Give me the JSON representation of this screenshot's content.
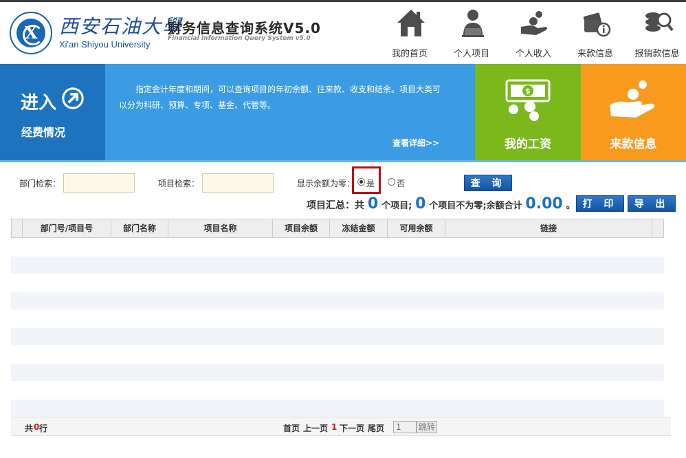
{
  "header": {
    "university_cn": "西安石油大學",
    "university_en": "Xi'an Shiyou University",
    "system_title": "财务信息查询系统V5.0",
    "system_subtitle": "Financial Information Query System v5.0",
    "nav": [
      {
        "label": "我的首页",
        "icon": "home-icon"
      },
      {
        "label": "个人项目",
        "icon": "person-icon"
      },
      {
        "label": "个人收入",
        "icon": "hand-coins-icon"
      },
      {
        "label": "来款信息",
        "icon": "money-info-icon"
      },
      {
        "label": "报销款信息",
        "icon": "coins-search-icon"
      }
    ]
  },
  "banner": {
    "enter_title": "进入",
    "enter_subtitle": "经费情况",
    "description": "指定会计年度和期间，可以查询项目的年初余额、往来款、收支和结余。项目大类可以分为科研、预算、专项、基金、代管等。",
    "more_link": "查看详细>>",
    "salary_label": "我的工资",
    "funds_label": "来款信息"
  },
  "search": {
    "dept_label": "部门检索：",
    "dept_value": "",
    "project_label": "项目检索：",
    "project_value": "",
    "zero_label": "显示余额为零：",
    "yes_label": "是",
    "no_label": "否",
    "zero_selected": "是",
    "query_button": "查 询",
    "print_button": "打 印",
    "export_button": "导 出"
  },
  "summary": {
    "prefix": "项目汇总：共",
    "total": "0",
    "mid": "个项目;",
    "nonzero": "0",
    "mid2": "个项目不为零;余额合计",
    "amount": "0.00",
    "suffix": "。"
  },
  "table": {
    "columns": [
      "部门号/项目号",
      "部门名称",
      "项目名称",
      "项目余额",
      "冻结金额",
      "可用余额",
      "链接"
    ],
    "rows": []
  },
  "pager": {
    "total_prefix": "共",
    "total_rows": "0",
    "total_suffix": "行",
    "first": "首页",
    "prev": "上一页",
    "current": "1",
    "next": "下一页",
    "last": "尾页",
    "page_input": "1",
    "jump": "跳转"
  },
  "colors": {
    "enter_blue": "#1e73be",
    "desc_blue": "#3b9be3",
    "salary_green": "#7ab81c",
    "funds_orange": "#f79a1e",
    "highlight_red": "#b3131e"
  }
}
